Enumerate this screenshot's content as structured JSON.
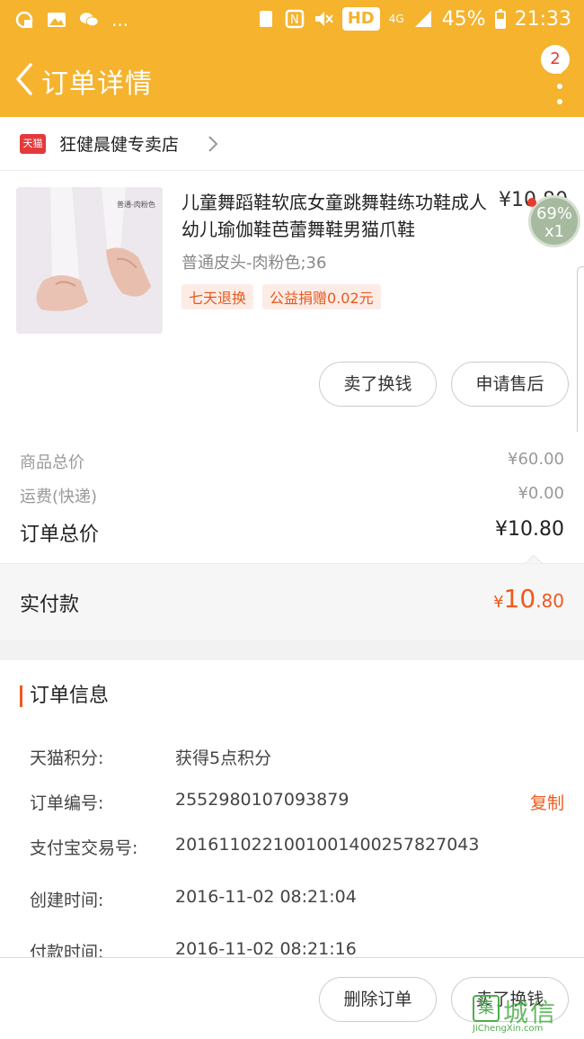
{
  "status_bar": {
    "hd_label": "HD",
    "network_label": "4G",
    "battery": "45%",
    "time": "21:33",
    "more_dots": "..."
  },
  "header": {
    "title": "订单详情",
    "badge_count": "2",
    "color": "#f5b32e"
  },
  "store": {
    "logo_text": "天猫",
    "name": "狂健晨健专卖店"
  },
  "product": {
    "title": "儿童舞蹈鞋软底女童跳舞鞋练功鞋成人幼儿瑜伽鞋芭蕾舞鞋男猫爪鞋",
    "price": "¥10.80",
    "quantity": "x1",
    "spec": "普通皮头-肉粉色;36",
    "thumb_caption": "普通-肉粉色",
    "tags": [
      "七天退换",
      "公益捐赠0.02元"
    ],
    "actions": [
      "卖了换钱",
      "申请售后"
    ]
  },
  "float_widget": {
    "percent": "69%",
    "quantity": "x1"
  },
  "summary": {
    "rows": [
      {
        "label": "商品总价",
        "value": "¥60.00"
      },
      {
        "label": "运费(快递)",
        "value": "¥0.00"
      }
    ],
    "total_label": "订单总价",
    "total_value": "¥10.80",
    "paid_label": "实付款",
    "paid_currency": "¥",
    "paid_int": "10",
    "paid_dec": ".80",
    "accent_color": "#f0581d"
  },
  "order_info": {
    "heading": "订单信息",
    "rows": [
      {
        "label": "天猫积分:",
        "value": "获得5点积分"
      },
      {
        "label": "订单编号:",
        "value": "2552980107093879",
        "action": "复制"
      },
      {
        "label": "支付宝交易号:",
        "value": "2016110221001001400257827043"
      },
      {
        "label": "创建时间:",
        "value": "2016-11-02 08:21:04"
      },
      {
        "label": "付款时间:",
        "value": "2016-11-02 08:21:16"
      }
    ]
  },
  "bottom_bar": {
    "actions": [
      "删除订单",
      "卖了换钱"
    ]
  },
  "watermark": {
    "logo": "集",
    "text": "城信",
    "sub": "JiChengXin.com"
  }
}
